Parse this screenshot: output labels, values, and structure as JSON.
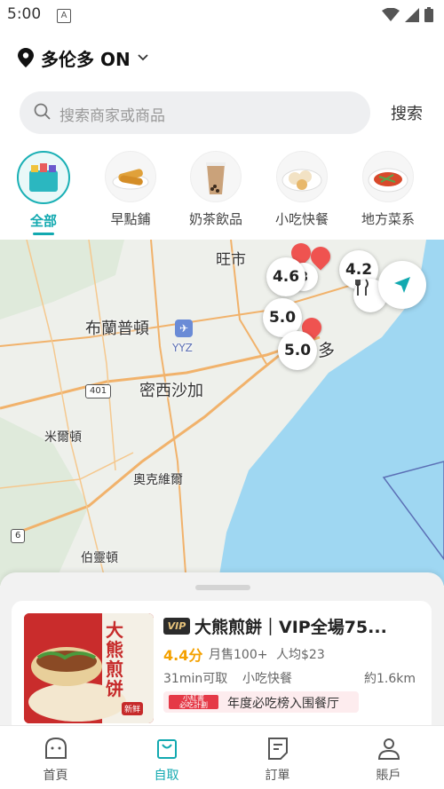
{
  "status_bar": {
    "time": "5:00",
    "notification_icon": "A"
  },
  "location": {
    "city": "多伦多 ON"
  },
  "search": {
    "placeholder": "搜索商家或商品",
    "button_label": "搜索"
  },
  "categories": [
    {
      "label": "全部",
      "active": true
    },
    {
      "label": "早點鋪"
    },
    {
      "label": "奶茶飲品"
    },
    {
      "label": "小吃快餐"
    },
    {
      "label": "地方菜系"
    }
  ],
  "map": {
    "places": [
      "旺市",
      "布蘭普頓",
      "密西沙加",
      "米爾頓",
      "奧克維爾",
      "伯靈頓",
      "多"
    ],
    "airport_code": "YYZ",
    "road_numbers": [
      "401",
      "6"
    ],
    "ratings": [
      "4.6",
      "4.2",
      "5.0",
      "5.0"
    ],
    "marker_digit": "3"
  },
  "store": {
    "vip": "VIP",
    "name": "大熊煎餅｜VIP全場75...",
    "score": "4.4分",
    "monthly_sales": "月售100+",
    "avg_price": "人均$23",
    "pickup_time": "31min可取",
    "category": "小吃快餐",
    "distance": "約1.6km",
    "promo_logo_line1": "小紅書",
    "promo_logo_line2": "必吃計劃",
    "promo_text": "年度必吃榜入围餐厅",
    "image_text": "大熊煎饼",
    "image_badge": "新鲜"
  },
  "nav": [
    {
      "label": "首頁"
    },
    {
      "label": "自取",
      "active": true
    },
    {
      "label": "訂單"
    },
    {
      "label": "賬戶"
    }
  ],
  "colors": {
    "accent": "#12a9b0",
    "score": "#f4a100",
    "water": "#9fd7f2",
    "pin": "#ef5350"
  }
}
